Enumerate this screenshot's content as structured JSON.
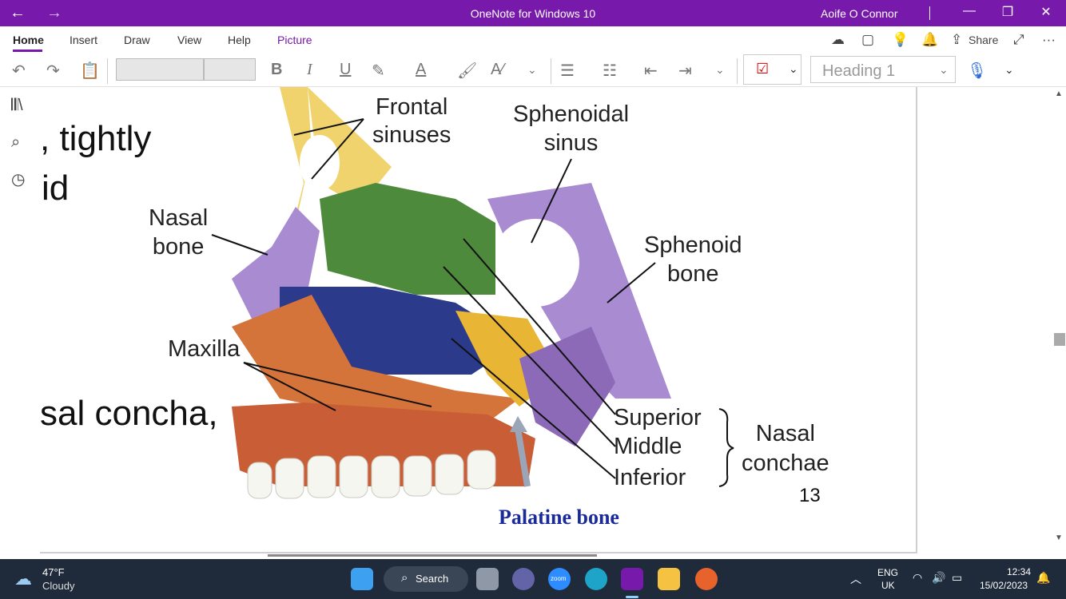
{
  "titlebar": {
    "title": "OneNote for Windows 10",
    "user": "Aoife O Connor",
    "back": "←",
    "forward": "→",
    "minimize": "—",
    "restore": "❐",
    "close": "✕"
  },
  "menu": {
    "tabs": [
      "Home",
      "Insert",
      "Draw",
      "View",
      "Help",
      "Picture"
    ],
    "share_label": "Share",
    "more": "···"
  },
  "toolbar": {
    "bold": "B",
    "italic": "I",
    "underline": "U",
    "font_color": "A",
    "style_value": "Heading 1"
  },
  "slide": {
    "text_1": ", tightly",
    "text_2": "id",
    "text_3": "sal  concha,",
    "page_number": "13"
  },
  "diagram_labels": {
    "frontal": "Frontal\nsinuses",
    "sphenoidal": "Sphenoidal\nsinus",
    "nasal_bone": "Nasal\nbone",
    "sphenoid_bone": "Sphenoid\nbone",
    "maxilla": "Maxilla",
    "superior": "Superior",
    "middle": "Middle",
    "inferior": "Inferior",
    "nasal_conchae": "Nasal\nconchae",
    "palatine": "Palatine bone"
  },
  "taskbar": {
    "temperature": "47°F",
    "weather": "Cloudy",
    "search_label": "Search",
    "zoom_label": "zoom",
    "lang_1": "ENG",
    "lang_2": "UK",
    "time": "12:34",
    "date": "15/02/2023"
  },
  "colors": {
    "accent": "#7719aa",
    "taskbar": "#1f2a3a"
  }
}
